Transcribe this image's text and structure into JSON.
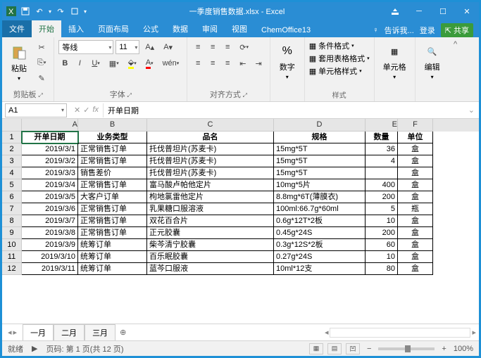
{
  "title_file": "一季度销售数据.xlsx",
  "title_app": "Excel",
  "qat": {
    "save": "save",
    "undo": "undo",
    "redo": "redo",
    "rect": "rect"
  },
  "tabs": {
    "file": "文件",
    "home": "开始",
    "insert": "插入",
    "layout": "页面布局",
    "formulas": "公式",
    "data": "数据",
    "review": "审阅",
    "view": "视图",
    "chem": "ChemOffice13"
  },
  "tell_me": "告诉我...",
  "signin": "登录",
  "share": "共享",
  "groups": {
    "clipboard": "剪贴板",
    "font": "字体",
    "align": "对齐方式",
    "number": "数字",
    "styles": "样式",
    "cells": "单元格",
    "editing": "编辑"
  },
  "paste": "粘贴",
  "font_name": "等线",
  "font_size": "11",
  "cond_fmt": "条件格式",
  "table_fmt": "套用表格格式",
  "cell_style": "单元格样式",
  "cells_btn": "单元格",
  "editing_btn": "编辑",
  "namebox": "A1",
  "fx_value": "开单日期",
  "cols": [
    "A",
    "B",
    "C",
    "D",
    "E",
    "F"
  ],
  "headers": {
    "a": "开单日期",
    "b": "业务类型",
    "c": "品名",
    "d": "规格",
    "e": "数量",
    "f": "单位"
  },
  "rows": [
    {
      "n": "2",
      "a": "2019/3/1",
      "b": "正常销售订单",
      "c": "托伐普坦片(苏麦卡)",
      "d": "15mg*5T",
      "e": "36",
      "f": "盒"
    },
    {
      "n": "3",
      "a": "2019/3/2",
      "b": "正常销售订单",
      "c": "托伐普坦片(苏麦卡)",
      "d": "15mg*5T",
      "e": "4",
      "f": "盒"
    },
    {
      "n": "4",
      "a": "2019/3/3",
      "b": "销售差价",
      "c": "托伐普坦片(苏麦卡)",
      "d": "15mg*5T",
      "e": "",
      "f": "盒"
    },
    {
      "n": "5",
      "a": "2019/3/4",
      "b": "正常销售订单",
      "c": "富马酸卢帕他定片",
      "d": "10mg*5片",
      "e": "400",
      "f": "盒"
    },
    {
      "n": "6",
      "a": "2019/3/5",
      "b": "大客户订单",
      "c": "枸地氯雷他定片",
      "d": "8.8mg*6T(薄膜衣)",
      "e": "200",
      "f": "盒"
    },
    {
      "n": "7",
      "a": "2019/3/6",
      "b": "正常销售订单",
      "c": "乳果糖口服溶液",
      "d": "100ml:66.7g*60ml",
      "e": "5",
      "f": "瓶"
    },
    {
      "n": "8",
      "a": "2019/3/7",
      "b": "正常销售订单",
      "c": "双花百合片",
      "d": "0.6g*12T*2板",
      "e": "10",
      "f": "盒"
    },
    {
      "n": "9",
      "a": "2019/3/8",
      "b": "正常销售订单",
      "c": "正元胶囊",
      "d": "0.45g*24S",
      "e": "200",
      "f": "盒"
    },
    {
      "n": "10",
      "a": "2019/3/9",
      "b": "统筹订单",
      "c": "柴芩清宁胶囊",
      "d": "0.3g*12S*2板",
      "e": "60",
      "f": "盒"
    },
    {
      "n": "11",
      "a": "2019/3/10",
      "b": "统筹订单",
      "c": "百乐眠胶囊",
      "d": "0.27g*24S",
      "e": "10",
      "f": "盒"
    },
    {
      "n": "12",
      "a": "2019/3/11",
      "b": "统筹订单",
      "c": "蓝芩口服液",
      "d": "10ml*12支",
      "e": "80",
      "f": "盒"
    }
  ],
  "sheets": {
    "s1": "一月",
    "s2": "二月",
    "s3": "三月"
  },
  "status": {
    "ready": "就绪",
    "page": "页码: 第 1 页(共 12 页)",
    "zoom": "100%"
  }
}
